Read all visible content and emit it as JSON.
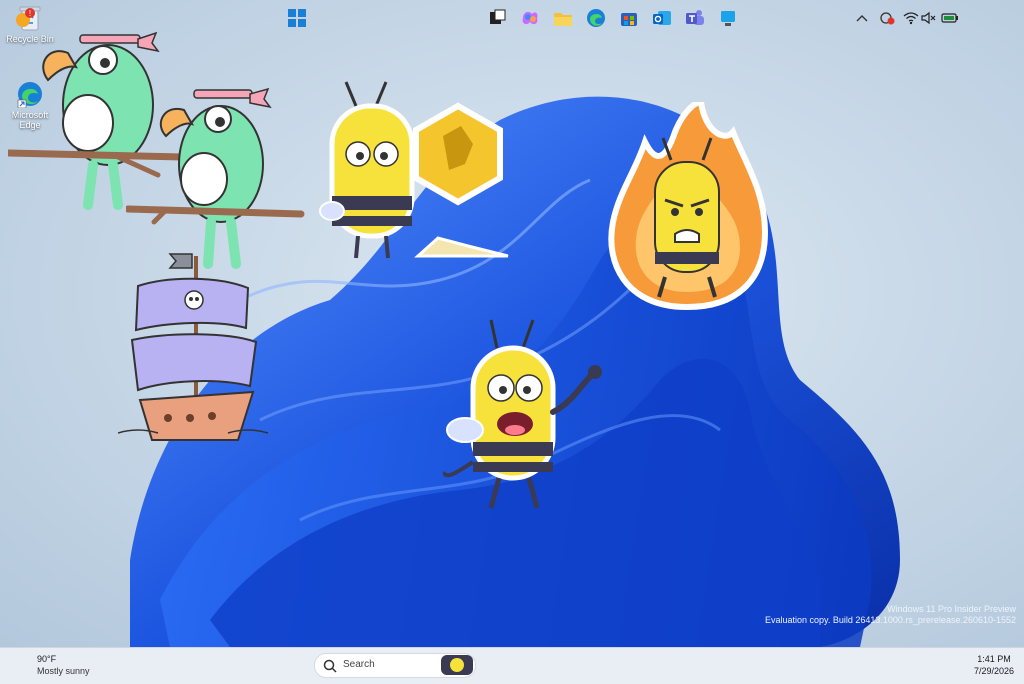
{
  "desktop": {
    "icons": [
      {
        "label": "Recycle Bin",
        "icon": "recycle-bin-icon"
      },
      {
        "label": "Microsoft Edge",
        "icon": "edge-icon"
      }
    ],
    "watermark": {
      "line1": "Windows 11 Pro Insider Preview",
      "line2": "Evaluation copy. Build 26413.1000.rs_prerelease.260610-1552"
    },
    "stickers": [
      "parrot-sticker",
      "parrot-sticker",
      "pirate-ship-sticker",
      "bee-with-honeycomb-sticker",
      "angry-fire-bee-sticker",
      "waving-bee-sticker"
    ]
  },
  "taskbar": {
    "weather": {
      "temp": "90°F",
      "condition": "Mostly sunny",
      "badge": "!"
    },
    "search": {
      "placeholder": "Search"
    },
    "pinned": [
      "start-icon",
      "task-view-icon",
      "copilot-icon",
      "file-explorer-icon",
      "edge-icon",
      "store-icon",
      "outlook-icon",
      "teams-icon",
      "snipping-icon"
    ],
    "tray": [
      "chevron-up-icon",
      "meet-icon",
      "wifi-icon",
      "volume-muted-icon",
      "battery-icon"
    ],
    "clock": {
      "time": "1:41 PM",
      "date": "7/29/2026"
    }
  },
  "colors": {
    "accent": "#1a5fd9",
    "bloom": "#1d56e0",
    "taskbar": "#e9eef5"
  }
}
